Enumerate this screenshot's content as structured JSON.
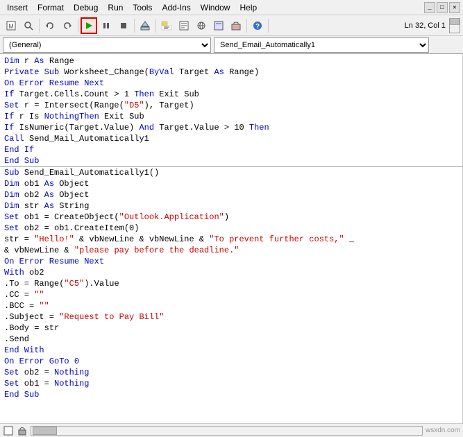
{
  "menubar": {
    "items": [
      "Insert",
      "Format",
      "Debug",
      "Run",
      "Tools",
      "Add-Ins",
      "Window",
      "Help"
    ]
  },
  "toolbar": {
    "position": "Ln 32, Col 1",
    "buttons": [
      {
        "name": "insert-module",
        "icon": "📄",
        "tooltip": "Insert"
      },
      {
        "name": "find",
        "icon": "🔍",
        "tooltip": "Find"
      },
      {
        "name": "undo",
        "icon": "↩",
        "tooltip": "Undo"
      },
      {
        "name": "redo",
        "icon": "↪",
        "tooltip": "Redo"
      },
      {
        "name": "run-macro",
        "icon": "▶",
        "tooltip": "Run",
        "active": true
      },
      {
        "name": "break",
        "icon": "⏸",
        "tooltip": "Break"
      },
      {
        "name": "reset",
        "icon": "⏹",
        "tooltip": "Reset"
      },
      {
        "name": "design-mode",
        "icon": "✏",
        "tooltip": "Design Mode"
      },
      {
        "name": "project-explorer",
        "icon": "📁",
        "tooltip": "Project Explorer"
      },
      {
        "name": "properties",
        "icon": "📋",
        "tooltip": "Properties"
      },
      {
        "name": "object-browser",
        "icon": "🔭",
        "tooltip": "Object Browser"
      },
      {
        "name": "userform",
        "icon": "🗔",
        "tooltip": "Userform"
      },
      {
        "name": "toolbox",
        "icon": "🔧",
        "tooltip": "Toolbox"
      },
      {
        "name": "help",
        "icon": "?",
        "tooltip": "Help"
      }
    ]
  },
  "dropdowns": {
    "left": "(General)",
    "right": "Send_Email_Automatically1"
  },
  "code": {
    "lines": [
      {
        "text": "Dim r As Range",
        "type": "normal"
      },
      {
        "text": "Private Sub Worksheet_Change(ByVal Target As Range)",
        "type": "normal"
      },
      {
        "text": "On Error Resume Next",
        "type": "keyword"
      },
      {
        "text": "If Target.Cells.Count > 1 Then Exit Sub",
        "type": "normal"
      },
      {
        "text": "Set r = Intersect(Range(\"D5\"), Target)",
        "type": "normal"
      },
      {
        "text": "If r Is Nothing Then Exit Sub",
        "type": "normal"
      },
      {
        "text": "If IsNumeric(Target.Value) And Target.Value > 10 Then",
        "type": "normal"
      },
      {
        "text": "Call Send_Mail_Automatically1",
        "type": "normal"
      },
      {
        "text": "End If",
        "type": "keyword"
      },
      {
        "text": "End Sub",
        "type": "keyword"
      },
      {
        "text": "---separator---",
        "type": "separator"
      },
      {
        "text": "Sub Send_Email_Automatically1()",
        "type": "normal"
      },
      {
        "text": "Dim ob1 As Object",
        "type": "normal"
      },
      {
        "text": "Dim ob2 As Object",
        "type": "normal"
      },
      {
        "text": "Dim str As String",
        "type": "normal"
      },
      {
        "text": "Set ob1 = CreateObject(\"Outlook.Application\")",
        "type": "normal"
      },
      {
        "text": "Set ob2 = ob1.CreateItem(0)",
        "type": "normal"
      },
      {
        "text": "str = \"Hello!\" & vbNewLine & vbNewLine & \"To prevent further costs,\" _",
        "type": "normal"
      },
      {
        "text": "& vbNewLine & \"please pay before the deadline.\"",
        "type": "normal"
      },
      {
        "text": "On Error Resume Next",
        "type": "keyword"
      },
      {
        "text": "With ob2",
        "type": "normal"
      },
      {
        "text": ".To = Range(\"C5\").Value",
        "type": "normal"
      },
      {
        "text": ".CC = \"\"",
        "type": "normal"
      },
      {
        "text": ".BCC = \"\"",
        "type": "normal"
      },
      {
        "text": ".Subject = \"Request to Pay Bill\"",
        "type": "normal"
      },
      {
        "text": ".Body = str",
        "type": "normal"
      },
      {
        "text": ".Send",
        "type": "normal"
      },
      {
        "text": "End With",
        "type": "keyword"
      },
      {
        "text": "On Error GoTo 0",
        "type": "keyword"
      },
      {
        "text": "Set ob2 = Nothing",
        "type": "normal"
      },
      {
        "text": "Set ob1 = Nothing",
        "type": "normal"
      },
      {
        "text": "End Sub",
        "type": "keyword"
      }
    ]
  },
  "statusbar": {
    "watermark": "wsxdn.com"
  }
}
